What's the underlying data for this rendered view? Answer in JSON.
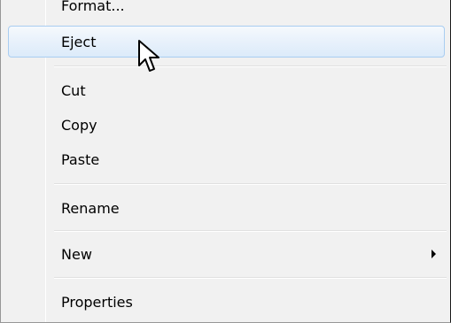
{
  "menu": {
    "items": [
      {
        "label": "Format...",
        "state": "partially-visible"
      },
      {
        "label": "Eject",
        "state": "hovered"
      },
      {
        "label": "Cut"
      },
      {
        "label": "Copy"
      },
      {
        "label": "Paste"
      },
      {
        "label": "Rename"
      },
      {
        "label": "New",
        "has_submenu": true
      },
      {
        "label": "Properties"
      }
    ]
  },
  "icons": {
    "submenu_arrow": "triangle-right-icon",
    "cursor": "mouse-pointer-icon"
  },
  "colors": {
    "menu_background": "#f1f1f1",
    "hover_border": "#a9cdf1",
    "hover_fill": "#dcebfa",
    "text": "#000000"
  }
}
